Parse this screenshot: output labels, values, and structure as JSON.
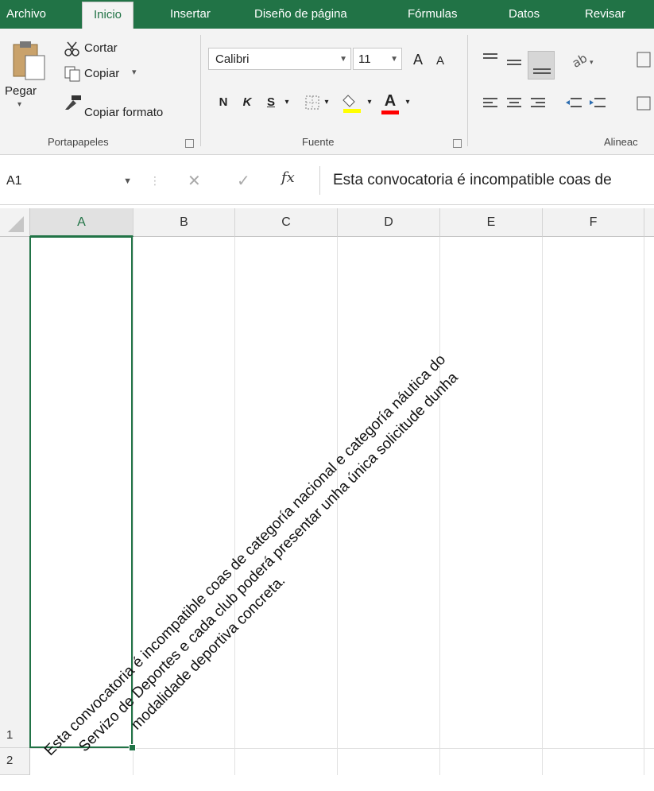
{
  "tabs": [
    "Archivo",
    "Inicio",
    "Insertar",
    "Diseño de página",
    "Fórmulas",
    "Datos",
    "Revisar"
  ],
  "active_tab": "Inicio",
  "clipboard": {
    "paste_label": "Pegar",
    "cut_label": "Cortar",
    "copy_label": "Copiar",
    "format_painter_label": "Copiar formato",
    "group_label": "Portapapeles"
  },
  "font": {
    "name": "Calibri",
    "size": "11",
    "bold": "N",
    "italic": "K",
    "underline": "S",
    "grow": "A",
    "shrink": "A",
    "color_letter": "A",
    "group_label": "Fuente"
  },
  "alignment": {
    "group_label": "Alineac"
  },
  "formula_bar": {
    "name_box": "A1",
    "fx": "fx",
    "content": "Esta convocatoria é incompatible coas de"
  },
  "columns": [
    "A",
    "B",
    "C",
    "D",
    "E",
    "F"
  ],
  "rows": [
    "1",
    "2"
  ],
  "cell_a1": {
    "lines": [
      "Esta convocatoria é incompatible coas de categoría nacional e categoría náutica do",
      "Servizo de Deportes e cada club poderá presentar unha única solicitude dunha",
      "modalidade deportiva concreta."
    ]
  },
  "colors": {
    "accent": "#217346",
    "fill_yellow": "#ffff00",
    "font_red": "#ff0000"
  }
}
